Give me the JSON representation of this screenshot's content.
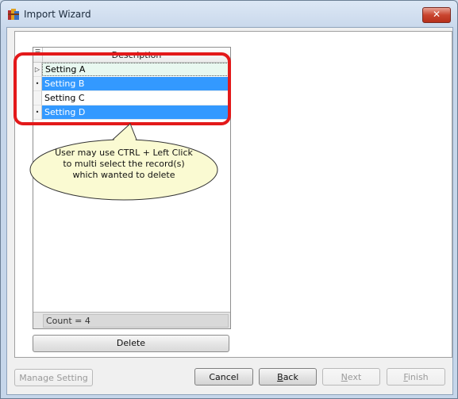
{
  "window": {
    "title": "Import Wizard",
    "close_label": "✕"
  },
  "grid": {
    "column_header": "Description",
    "rows": [
      {
        "label": "Setting A",
        "indicator": "▷",
        "state": "current"
      },
      {
        "label": "Setting B",
        "indicator": "•",
        "state": "selected"
      },
      {
        "label": "Setting C",
        "indicator": "",
        "state": "normal"
      },
      {
        "label": "Setting D",
        "indicator": "•",
        "state": "selected"
      }
    ],
    "footer": "Count = 4"
  },
  "callout": {
    "line1": "User may use CTRL + Left Click",
    "line2": "to multi select the record(s)",
    "line3": "which wanted to delete"
  },
  "buttons": {
    "delete": "Delete",
    "manage_setting": "Manage Setting",
    "cancel": "Cancel",
    "back": "Back",
    "next": "Next",
    "finish": "Finish"
  },
  "colors": {
    "selection": "#3399ff",
    "highlight": "#e3191a",
    "callout_fill": "#fafad2"
  }
}
